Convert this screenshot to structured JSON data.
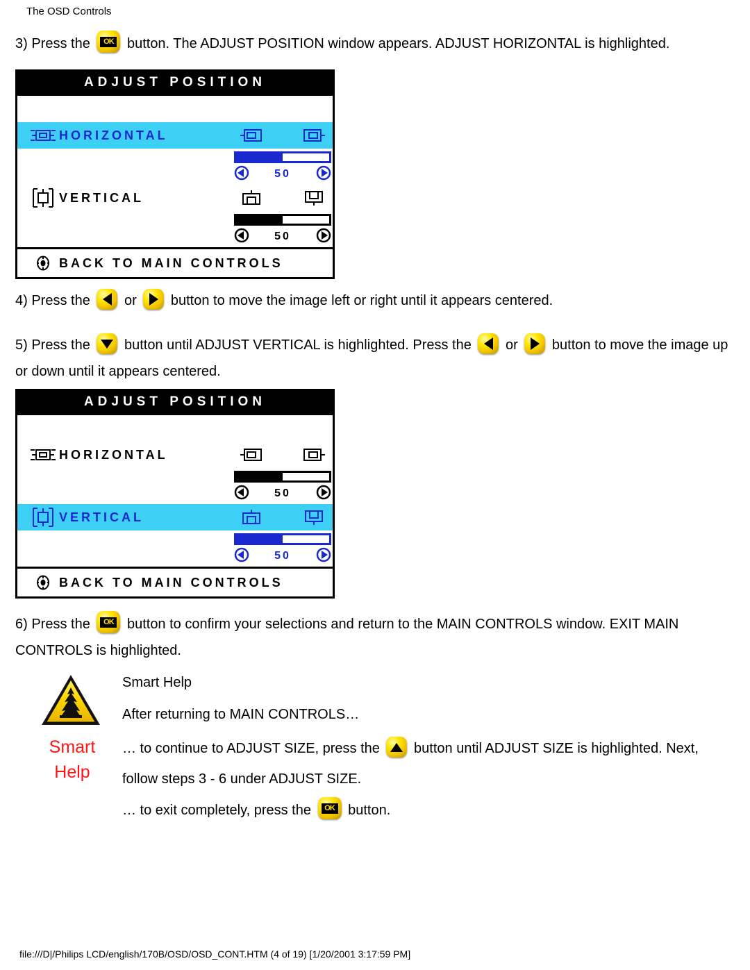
{
  "header": {
    "title": "The OSD Controls"
  },
  "steps": {
    "step3": {
      "pre": "3) Press the",
      "icon": "ok-button-icon",
      "post": "button. The ADJUST POSITION window appears. ADJUST HORIZONTAL is highlighted."
    },
    "step4": {
      "pre": "4) Press the",
      "icon_left": "left-arrow-button-icon",
      "mid": "or",
      "icon_right": "right-arrow-button-icon",
      "post": "button to move the image left or right until it appears centered."
    },
    "step5": {
      "pre": "5) Press the",
      "icon_down": "down-arrow-button-icon",
      "mid1": "button until ADJUST VERTICAL is highlighted. Press the",
      "icon_left": "left-arrow-button-icon",
      "mid2": "or",
      "icon_right": "right-arrow-button-icon",
      "post": "button to move the",
      "line2": "image up or down until it appears centered."
    },
    "step6": {
      "pre": "6) Press the",
      "icon": "ok-button-icon",
      "post": "button to confirm your selections and return to the MAIN CONTROLS window. EXIT MAIN",
      "line2": "CONTROLS is highlighted."
    }
  },
  "osd_panel_1": {
    "title": "ADJUST POSITION",
    "rows": [
      {
        "label": "HORIZONTAL",
        "lead_icon": "horizontal-position-icon",
        "mini_icon_1": "shift-left-icon",
        "mini_icon_2": "shift-right-icon",
        "highlighted": true,
        "value": "50",
        "fill_percent": 50
      },
      {
        "label": "VERTICAL",
        "lead_icon": "vertical-position-icon",
        "mini_icon_1": "shift-up-icon",
        "mini_icon_2": "shift-down-icon",
        "highlighted": false,
        "value": "50",
        "fill_percent": 50
      }
    ],
    "footer": {
      "label": "BACK TO MAIN CONTROLS",
      "icon": "back-target-icon"
    }
  },
  "osd_panel_2": {
    "title": "ADJUST POSITION",
    "rows": [
      {
        "label": "HORIZONTAL",
        "lead_icon": "horizontal-position-icon",
        "mini_icon_1": "shift-left-icon",
        "mini_icon_2": "shift-right-icon",
        "highlighted": false,
        "value": "50",
        "fill_percent": 50
      },
      {
        "label": "VERTICAL",
        "lead_icon": "vertical-position-icon",
        "mini_icon_1": "shift-up-icon",
        "mini_icon_2": "shift-down-icon",
        "highlighted": true,
        "value": "50",
        "fill_percent": 50
      }
    ],
    "footer": {
      "label": "BACK TO MAIN CONTROLS",
      "icon": "back-target-icon"
    }
  },
  "smart_help": {
    "warning_icon": "warning-triangle-icon",
    "heading": "Smart Help",
    "intro": "After returning to MAIN CONTROLS…",
    "badge_line1": "Smart",
    "badge_line2": "Help",
    "body_line1_pre": "… to continue to ADJUST SIZE, press the",
    "body_line1_icon": "up-arrow-button-icon",
    "body_line1_post": "button until ADJUST SIZE is",
    "body_line2": "highlighted. Next, follow steps 3 - 6 under ADJUST SIZE.",
    "body_line3_pre": "… to exit completely, press the",
    "body_line3_icon": "ok-button-icon",
    "body_line3_post": "button."
  },
  "footer": {
    "path": "file:///D|/Philips LCD/english/170B/OSD/OSD_CONT.HTM (4 of 19) [1/20/2001 3:17:59 PM]"
  },
  "colors": {
    "highlight_cyan": "#3ecff5",
    "osd_blue": "#1a29cf",
    "smart_help_red": "#ff1414",
    "button_yellow": "#ffe600"
  },
  "ok_label": "OK"
}
